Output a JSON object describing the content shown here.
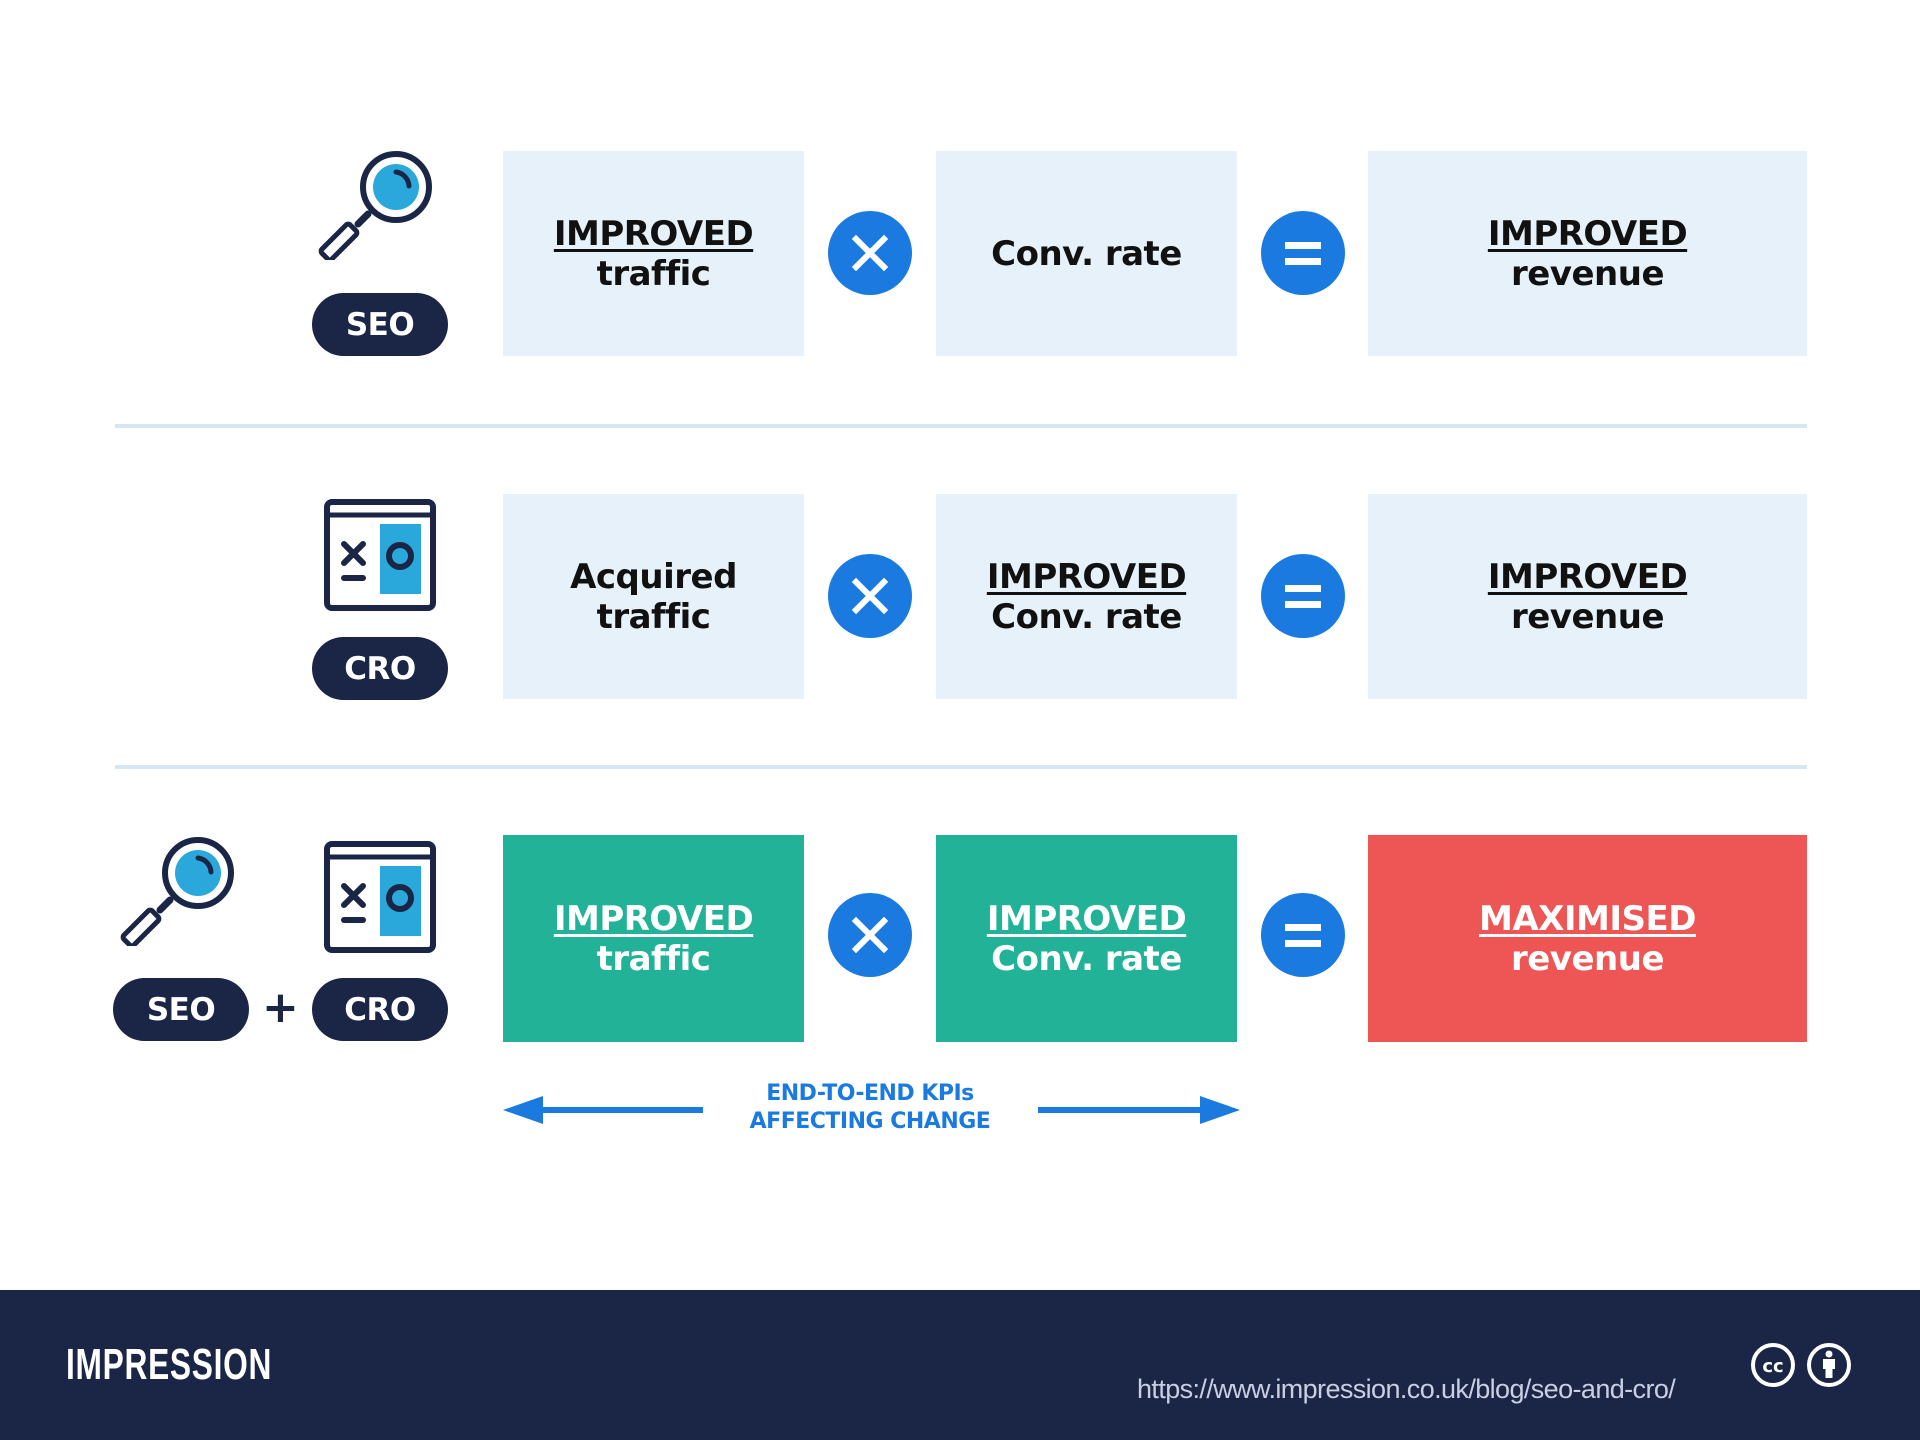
{
  "rows": [
    {
      "icons": [
        "magnifier"
      ],
      "badges": [
        "SEO"
      ],
      "left_box": {
        "highlight": "IMPROVED",
        "text": "traffic",
        "style": "light"
      },
      "middle_box": {
        "highlight": "",
        "text": "Conv. rate",
        "style": "light"
      },
      "result_box": {
        "highlight": "IMPROVED",
        "text": "revenue",
        "style": "light"
      }
    },
    {
      "icons": [
        "cro-window"
      ],
      "badges": [
        "CRO"
      ],
      "left_box": {
        "highlight": "",
        "text": "Acquired traffic",
        "line1": "Acquired",
        "line2": "traffic",
        "style": "light"
      },
      "middle_box": {
        "highlight": "IMPROVED",
        "text": "Conv. rate",
        "style": "light"
      },
      "result_box": {
        "highlight": "IMPROVED",
        "text": "revenue",
        "style": "light"
      }
    },
    {
      "icons": [
        "magnifier",
        "cro-window"
      ],
      "badges": [
        "SEO",
        "CRO"
      ],
      "badge_joiner": "+",
      "left_box": {
        "highlight": "IMPROVED",
        "text": "traffic",
        "style": "green"
      },
      "middle_box": {
        "highlight": "IMPROVED",
        "text": "Conv. rate",
        "style": "green"
      },
      "result_box": {
        "highlight": "MAXIMISED",
        "text": "revenue",
        "style": "red"
      }
    }
  ],
  "operators": {
    "multiply": "multiply-icon",
    "equals": "equals-icon"
  },
  "annotation": {
    "line1": "END-TO-END KPIs",
    "line2": "AFFECTING CHANGE"
  },
  "footer": {
    "logo": "IMPRESSION",
    "url": "https://www.impression.co.uk/blog/seo-and-cro/",
    "license_icons": [
      "creative-commons-icon",
      "attribution-icon"
    ]
  },
  "colors": {
    "navy": "#1b2646",
    "accent_blue": "#1a7ae0",
    "light_box": "#e6f1fa",
    "green": "#22b297",
    "red": "#ee5656",
    "icon_fill": "#2aa8dc",
    "separator": "#d6e6f2"
  }
}
